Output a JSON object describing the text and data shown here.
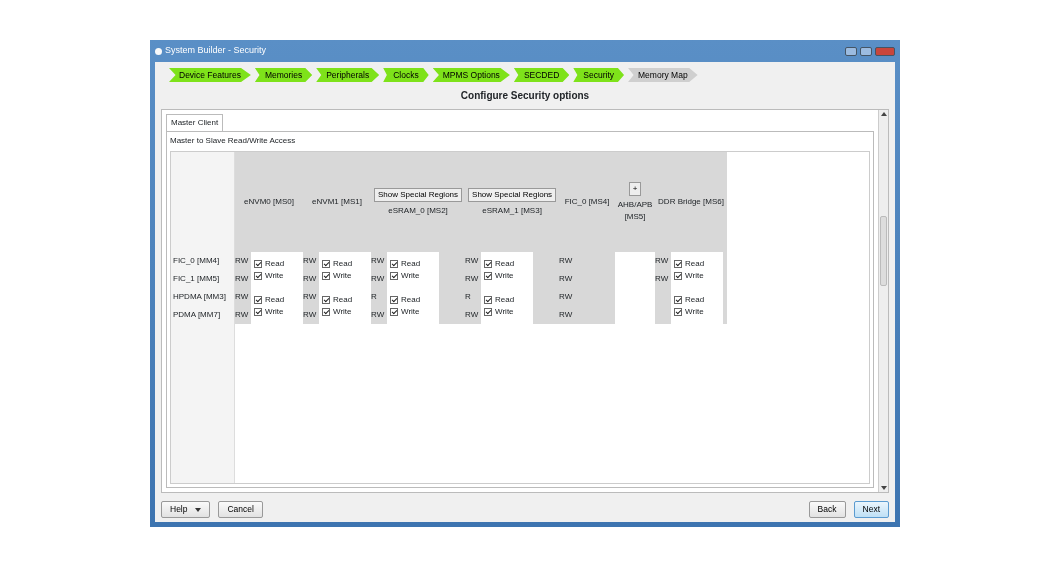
{
  "window": {
    "title": "System Builder - Security"
  },
  "steps": [
    {
      "label": "Device Features",
      "completed": true
    },
    {
      "label": "Memories",
      "completed": true
    },
    {
      "label": "Peripherals",
      "completed": true
    },
    {
      "label": "Clocks",
      "completed": true
    },
    {
      "label": "MPMS Options",
      "completed": true
    },
    {
      "label": "SECDED",
      "completed": true
    },
    {
      "label": "Security",
      "completed": true
    },
    {
      "label": "Memory Map",
      "completed": false
    }
  ],
  "heading": "Configure Security options",
  "tabs": [
    {
      "label": "Master Client",
      "selected": true
    }
  ],
  "section_title": "Master to Slave Read/Write Access",
  "masters": [
    "FIC_0 [MM4]",
    "FIC_1 [MM5]",
    "HPDMA [MM3]",
    "PDMA [MM7]"
  ],
  "slaves": [
    {
      "label": "eNVM0 [MS0]",
      "access": [
        "RW",
        "RW",
        "RW",
        "RW"
      ],
      "groups": [
        [
          {
            "label": "Read",
            "checked": true
          },
          {
            "label": "Write",
            "checked": true
          }
        ],
        [
          {
            "label": "Read",
            "checked": true
          },
          {
            "label": "Write",
            "checked": true
          }
        ]
      ]
    },
    {
      "label": "eNVM1 [MS1]",
      "access": [
        "RW",
        "RW",
        "RW",
        "RW"
      ],
      "groups": [
        [
          {
            "label": "Read",
            "checked": true
          },
          {
            "label": "Write",
            "checked": true
          }
        ],
        [
          {
            "label": "Read",
            "checked": true
          },
          {
            "label": "Write",
            "checked": true
          }
        ]
      ]
    },
    {
      "label": "eSRAM_0 [MS2]",
      "button": "Show Special Regions",
      "access": [
        "RW",
        "RW",
        "R",
        "RW"
      ],
      "groups": [
        [
          {
            "label": "Read",
            "checked": true
          },
          {
            "label": "Write",
            "checked": true
          }
        ],
        [
          {
            "label": "Read",
            "checked": true
          },
          {
            "label": "Write",
            "checked": true
          }
        ]
      ]
    },
    {
      "label": "eSRAM_1 [MS3]",
      "button": "Show Special Regions",
      "access": [
        "RW",
        "RW",
        "R",
        "RW"
      ],
      "groups": [
        [
          {
            "label": "Read",
            "checked": true
          },
          {
            "label": "Write",
            "checked": true
          }
        ],
        [
          {
            "label": "Read",
            "checked": true
          },
          {
            "label": "Write",
            "checked": true
          }
        ]
      ]
    },
    {
      "label": "FIC_0 [MS4]",
      "access": [
        "RW",
        "RW",
        "RW",
        "RW"
      ]
    },
    {
      "label": "AHB/APB [MS5]",
      "button": "+"
    },
    {
      "label": "DDR Bridge [MS6]",
      "access": [
        "RW",
        "RW"
      ],
      "groups": [
        [
          {
            "label": "Read",
            "checked": true
          },
          {
            "label": "Write",
            "checked": true
          }
        ],
        [
          {
            "label": "Read",
            "checked": true
          },
          {
            "label": "Write",
            "checked": true
          }
        ]
      ]
    }
  ],
  "footer_left": [
    {
      "label": "Help",
      "caret": true
    },
    {
      "label": "Cancel",
      "caret": false
    }
  ],
  "footer_right": [
    "Back",
    "Next"
  ]
}
